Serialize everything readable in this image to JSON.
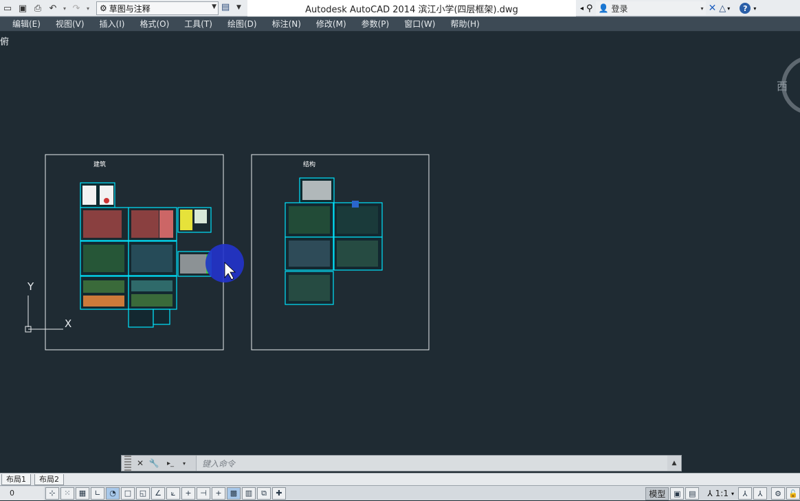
{
  "window": {
    "title": "Autodesk AutoCAD 2014    滨江小学(四层框架).dwg",
    "workspace": "草图与注释",
    "login": "登录"
  },
  "menu": [
    "编辑(E)",
    "视图(V)",
    "插入(I)",
    "格式(O)",
    "工具(T)",
    "绘图(D)",
    "标注(N)",
    "修改(M)",
    "参数(P)",
    "窗口(W)",
    "帮助(H)"
  ],
  "viewport": {
    "corner_label": "俯",
    "viewcube_label": "西",
    "ucs_x": "X",
    "ucs_y": "Y",
    "frame_left_title": "建筑",
    "frame_right_title": "结构"
  },
  "command": {
    "placeholder": "键入命令"
  },
  "layouts": [
    "布局1",
    "布局2"
  ],
  "status": {
    "coord": "0",
    "model_label": "模型",
    "scale": "1:1"
  },
  "colors": {
    "canvas": "#1f2b33",
    "drawing_cyan": "#00e5ff",
    "cursor_highlight": "#2233cc"
  }
}
